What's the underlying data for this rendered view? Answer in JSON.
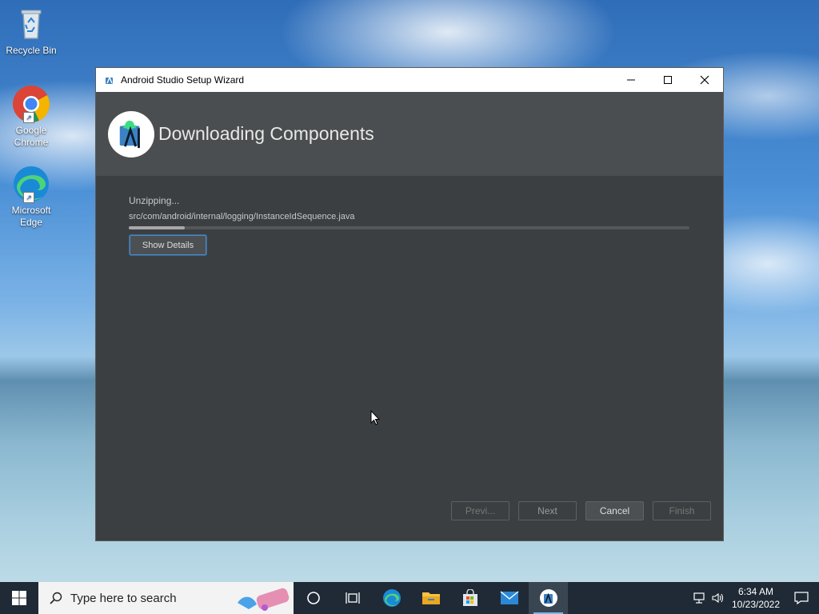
{
  "desktop": {
    "icons": [
      {
        "label": "Recycle Bin"
      },
      {
        "label": "Google Chrome"
      },
      {
        "label": "Microsoft Edge"
      }
    ]
  },
  "window": {
    "title": "Android Studio Setup Wizard",
    "header_title": "Downloading Components",
    "status": "Unzipping...",
    "file_path": "src/com/android/internal/logging/InstanceIdSequence.java",
    "progress_fraction": 0.1,
    "show_details_label": "Show Details",
    "buttons": {
      "previous": "Previ...",
      "next": "Next",
      "cancel": "Cancel",
      "finish": "Finish"
    }
  },
  "taskbar": {
    "search_placeholder": "Type here to search",
    "time": "6:34 AM",
    "date": "10/23/2022"
  },
  "colors": {
    "dialog_bg": "#3c3f41",
    "header_bg": "#4b4e50",
    "taskbar_bg": "#1f2a36",
    "focus_accent": "#4a88c7"
  }
}
